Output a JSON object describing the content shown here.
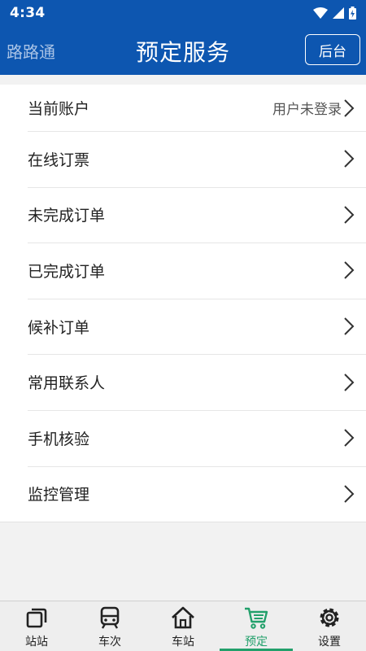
{
  "status_bar": {
    "time": "4:34"
  },
  "header": {
    "app_name": "路路通",
    "title": "预定服务",
    "backend_button": "后台"
  },
  "menu": [
    {
      "label": "当前账户",
      "value": "用户未登录"
    },
    {
      "label": "在线订票",
      "value": ""
    },
    {
      "label": "未完成订单",
      "value": ""
    },
    {
      "label": "已完成订单",
      "value": ""
    },
    {
      "label": "候补订单",
      "value": ""
    },
    {
      "label": "常用联系人",
      "value": ""
    },
    {
      "label": "手机核验",
      "value": ""
    },
    {
      "label": "监控管理",
      "value": ""
    }
  ],
  "bottom_nav": {
    "active_index": 3,
    "active_color": "#22a06b",
    "items": [
      {
        "label": "站站",
        "icon": "station-to-station-icon"
      },
      {
        "label": "车次",
        "icon": "train-icon"
      },
      {
        "label": "车站",
        "icon": "home-icon"
      },
      {
        "label": "预定",
        "icon": "shopping-cart-icon"
      },
      {
        "label": "设置",
        "icon": "gear-icon"
      }
    ]
  },
  "colors": {
    "header_blue": "#0d56b0",
    "app_name_color": "#a9c3e6",
    "background": "#f2f2f2"
  }
}
